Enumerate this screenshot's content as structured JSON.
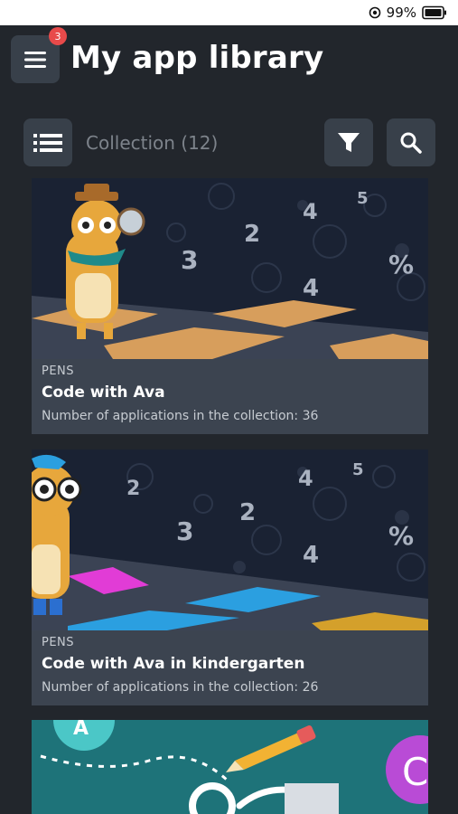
{
  "status": {
    "battery": "99%"
  },
  "header": {
    "title": "My app library",
    "menu_badge": "3"
  },
  "toolbar": {
    "collection_label": "Collection (12)"
  },
  "cards": [
    {
      "publisher": "PENS",
      "title": "Code with Ava",
      "count_text": "Number of applications in the collection: 36"
    },
    {
      "publisher": "PENS",
      "title": "Code with Ava in kindergarten",
      "count_text": "Number of applications in the collection: 26"
    }
  ],
  "colors": {
    "background": "#22262c",
    "button": "#38404a",
    "card": "#3c4450",
    "badge": "#e84a4a"
  },
  "icons": [
    "screen-rotation-icon",
    "battery-icon",
    "menu-icon",
    "list-icon",
    "filter-icon",
    "search-icon"
  ]
}
